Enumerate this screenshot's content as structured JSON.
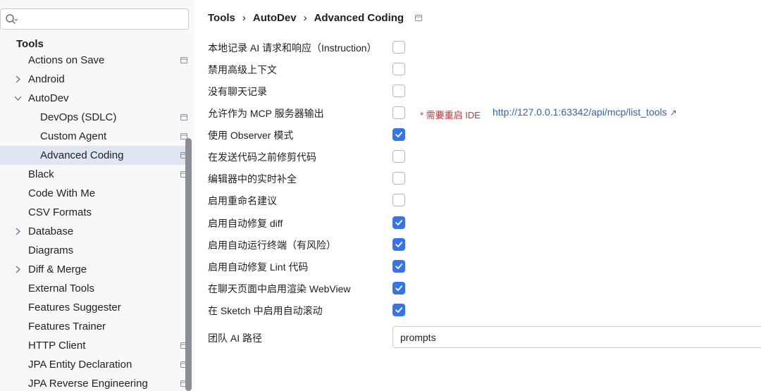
{
  "search": {
    "value": "",
    "placeholder": ""
  },
  "sidebar": {
    "header": "Tools",
    "items": [
      {
        "label": "Actions on Save",
        "level": 1,
        "expandable": false,
        "badge": true,
        "selected": false
      },
      {
        "label": "Android",
        "level": 1,
        "expandable": true,
        "expanded": false,
        "badge": false,
        "selected": false
      },
      {
        "label": "AutoDev",
        "level": 1,
        "expandable": true,
        "expanded": true,
        "badge": false,
        "selected": false
      },
      {
        "label": "DevOps (SDLC)",
        "level": 2,
        "expandable": false,
        "badge": true,
        "selected": false
      },
      {
        "label": "Custom Agent",
        "level": 2,
        "expandable": false,
        "badge": true,
        "selected": false
      },
      {
        "label": "Advanced Coding",
        "level": 2,
        "expandable": false,
        "badge": true,
        "selected": true
      },
      {
        "label": "Black",
        "level": 1,
        "expandable": false,
        "badge": true,
        "selected": false
      },
      {
        "label": "Code With Me",
        "level": 1,
        "expandable": false,
        "badge": false,
        "selected": false
      },
      {
        "label": "CSV Formats",
        "level": 1,
        "expandable": false,
        "badge": false,
        "selected": false
      },
      {
        "label": "Database",
        "level": 1,
        "expandable": true,
        "expanded": false,
        "badge": false,
        "selected": false
      },
      {
        "label": "Diagrams",
        "level": 1,
        "expandable": false,
        "badge": false,
        "selected": false
      },
      {
        "label": "Diff & Merge",
        "level": 1,
        "expandable": true,
        "expanded": false,
        "badge": false,
        "selected": false
      },
      {
        "label": "External Tools",
        "level": 1,
        "expandable": false,
        "badge": false,
        "selected": false
      },
      {
        "label": "Features Suggester",
        "level": 1,
        "expandable": false,
        "badge": false,
        "selected": false
      },
      {
        "label": "Features Trainer",
        "level": 1,
        "expandable": false,
        "badge": false,
        "selected": false
      },
      {
        "label": "HTTP Client",
        "level": 1,
        "expandable": false,
        "badge": true,
        "selected": false
      },
      {
        "label": "JPA Entity Declaration",
        "level": 1,
        "expandable": false,
        "badge": true,
        "selected": false
      },
      {
        "label": "JPA Reverse Engineering",
        "level": 1,
        "expandable": false,
        "badge": true,
        "selected": false
      }
    ]
  },
  "breadcrumb": {
    "items": [
      "Tools",
      "AutoDev",
      "Advanced Coding"
    ],
    "separator": "›"
  },
  "settings": [
    {
      "label": "本地记录 AI 请求和响应（Instruction）",
      "checked": false
    },
    {
      "label": "禁用高级上下文",
      "checked": false
    },
    {
      "label": "没有聊天记录",
      "checked": false
    },
    {
      "label": "允许作为 MCP 服务器输出",
      "checked": false
    },
    {
      "label": "使用 Observer 模式",
      "checked": true
    },
    {
      "label": "在发送代码之前修剪代码",
      "checked": false
    },
    {
      "label": "编辑器中的实时补全",
      "checked": false
    },
    {
      "label": "启用重命名建议",
      "checked": false
    },
    {
      "label": "启用自动修复 diff",
      "checked": true
    },
    {
      "label": "启用自动运行终端（有风险）",
      "checked": true
    },
    {
      "label": "启用自动修复 Lint 代码",
      "checked": true
    },
    {
      "label": "在聊天页面中启用渲染 WebView",
      "checked": true
    },
    {
      "label": "在 Sketch 中启用自动滚动",
      "checked": true
    }
  ],
  "mcp": {
    "restart_note": "* 需要重启 IDE",
    "link": "http://127.0.0.1:63342/api/mcp/list_tools",
    "link_icon": "external-link-icon"
  },
  "team_path": {
    "label": "团队 AI 路径",
    "value": "prompts"
  },
  "colors": {
    "accent": "#3574f0",
    "selection": "#dfe5f3",
    "warning": "#d62e2e",
    "link": "#2f5fcc"
  }
}
